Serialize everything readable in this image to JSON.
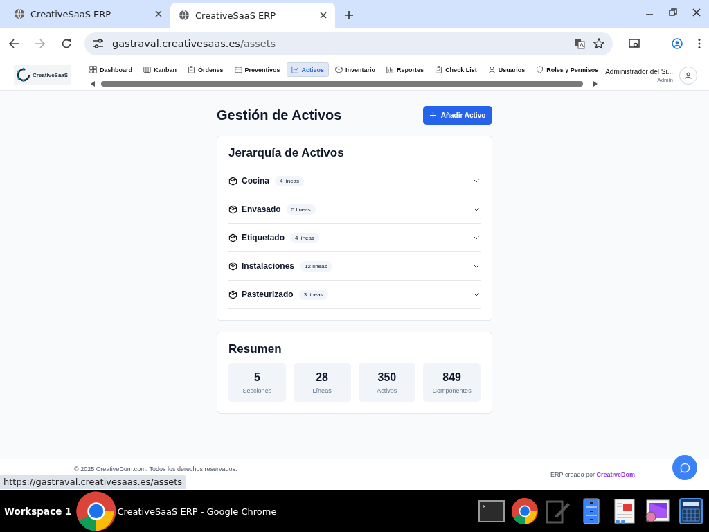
{
  "browser": {
    "tabs": [
      {
        "title": "CreativeSaaS ERP",
        "selected": false
      },
      {
        "title": "CreativeSaaS ERP",
        "selected": true
      }
    ],
    "url_host": "gastraval.creativesaas.es",
    "url_path": "/assets",
    "status_url": "https://gastraval.creativesaas.es/assets"
  },
  "app_nav": {
    "logo": "CreativeSaaS",
    "items": [
      {
        "label": "Dashboard",
        "selected": false
      },
      {
        "label": "Kanban",
        "selected": false
      },
      {
        "label": "Órdenes",
        "selected": false
      },
      {
        "label": "Preventivos",
        "selected": false
      },
      {
        "label": "Activos",
        "selected": true
      },
      {
        "label": "Inventario",
        "selected": false
      },
      {
        "label": "Reportes",
        "selected": false
      },
      {
        "label": "Check List",
        "selected": false
      },
      {
        "label": "Usuarios",
        "selected": false
      },
      {
        "label": "Roles y Permisos",
        "selected": false
      }
    ],
    "user": {
      "name": "Administrador del Si...",
      "role": "Admin"
    }
  },
  "page": {
    "title": "Gestión de Activos",
    "add_button": "Añadir Activo",
    "hierarchy": {
      "title": "Jerarquía de Activos",
      "sections": [
        {
          "name": "Cocina",
          "badge": "4 líneas",
          "expanded": false
        },
        {
          "name": "Envasado",
          "badge": "5 líneas",
          "expanded": false
        },
        {
          "name": "Etiquetado",
          "badge": "4 líneas",
          "expanded": false
        },
        {
          "name": "Instalaciones",
          "badge": "12 líneas",
          "expanded": false
        },
        {
          "name": "Pasteurizado",
          "badge": "3 líneas",
          "expanded": false
        }
      ]
    },
    "summary": {
      "title": "Resumen",
      "stats": [
        {
          "value": "5",
          "label": "Secciones"
        },
        {
          "value": "28",
          "label": "Líneas"
        },
        {
          "value": "350",
          "label": "Activos"
        },
        {
          "value": "849",
          "label": "Componentes"
        }
      ]
    }
  },
  "footer": {
    "copyright": "© 2025 CreativeDom.com. Todos los derechos reservados.",
    "credit": "ERP creado por",
    "credit_link": "CreativeDom"
  },
  "taskbar": {
    "workspace": "Workspace 1",
    "window_title": "CreativeSaaS ERP - Google Chrome"
  }
}
